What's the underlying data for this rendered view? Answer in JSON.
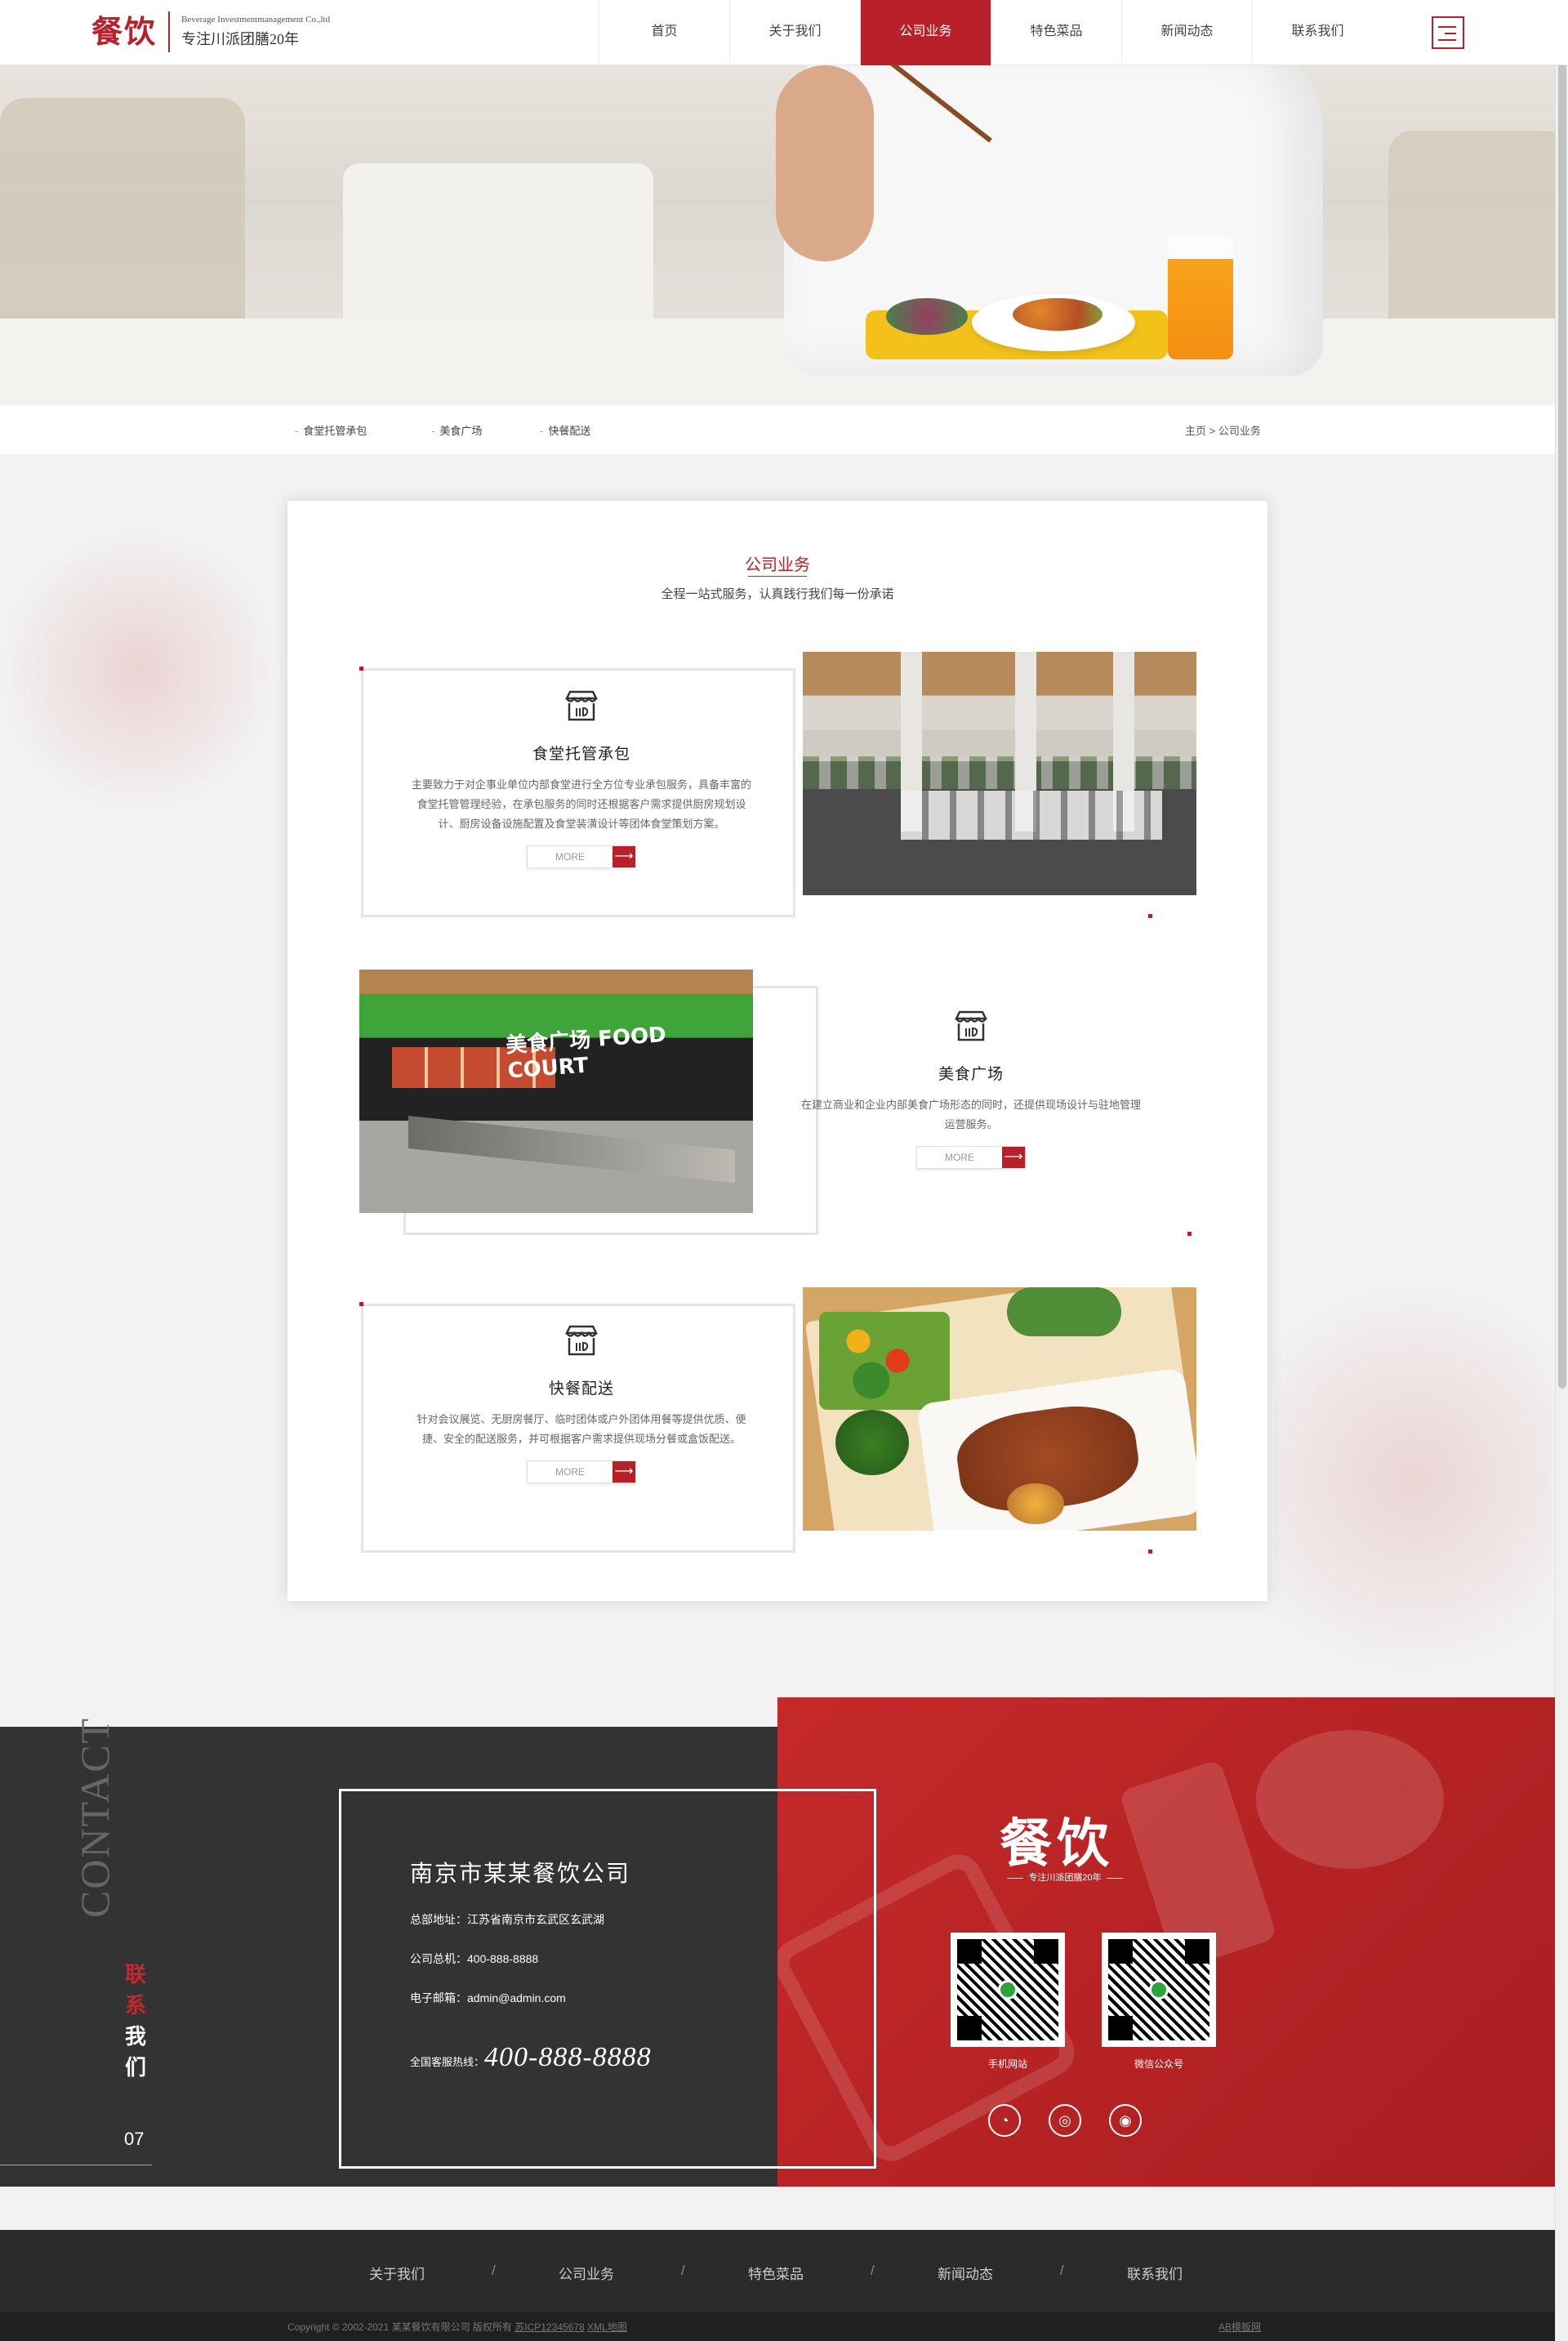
{
  "header": {
    "logo_mark": "餐饮",
    "logo_en": "Beverage Investmentmanagement Co.,ltd",
    "logo_cn": "专注川派团膳20年",
    "nav": [
      {
        "label": "首页",
        "active": false
      },
      {
        "label": "关于我们",
        "active": false
      },
      {
        "label": "公司业务",
        "active": true
      },
      {
        "label": "特色菜品",
        "active": false
      },
      {
        "label": "新闻动态",
        "active": false
      },
      {
        "label": "联系我们",
        "active": false
      }
    ],
    "menu_icon": "hamburger-icon"
  },
  "subnav": {
    "items": [
      "食堂托管承包",
      "美食广场",
      "快餐配送"
    ],
    "breadcrumb": "主页 > 公司业务"
  },
  "section": {
    "title": "公司业务",
    "subtitle": "全程一站式服务，认真践行我们每一份承诺"
  },
  "services": [
    {
      "title": "食堂托管承包",
      "desc": "主要致力于对企事业单位内部食堂进行全方位专业承包服务，具备丰富的食堂托管管理经验，在承包服务的同时还根据客户需求提供厨房规划设计、厨房设备设施配置及食堂装潢设计等团体食堂策划方案。",
      "more": "MORE",
      "icon": "market-stall-icon"
    },
    {
      "title": "美食广场",
      "desc": "在建立商业和企业内部美食广场形态的同时，还提供现场设计与驻地管理运营服务。",
      "more": "MORE",
      "icon": "market-stall-icon",
      "photo_sign": "美食广场 FOOD COURT"
    },
    {
      "title": "快餐配送",
      "desc": "针对会议展览、无厨房餐厅、临时团体或户外团体用餐等提供优质、便捷、安全的配送服务，并可根据客户需求提供现场分餐或盒饭配送。",
      "more": "MORE",
      "icon": "market-stall-icon"
    }
  ],
  "contact": {
    "vertical_en": "CONTACT",
    "vertical_cn": [
      "联",
      "系",
      "我",
      "们"
    ],
    "number": "07",
    "company": "南京市某某餐饮公司",
    "address": "总部地址：江苏省南京市玄武区玄武湖",
    "phone": "公司总机：400-888-8888",
    "email": "电子邮箱：admin@admin.com",
    "hotline_label": "全国客服热线：",
    "hotline": "400-888-8888",
    "brand": "餐饮",
    "brand_tag": "专注川派团膳20年",
    "qr_codes": [
      {
        "label": "手机网站"
      },
      {
        "label": "微信公众号"
      }
    ],
    "social_icons": [
      "qq-icon",
      "wechat-icon",
      "weibo-icon"
    ]
  },
  "footer": {
    "nav": [
      "关于我们",
      "公司业务",
      "特色菜品",
      "新闻动态",
      "联系我们"
    ],
    "separator": "/",
    "copyright": "Copyright © 2002-2021 某某餐饮有限公司 版权所有",
    "icp": "苏ICP12345678",
    "xml": "XML地图",
    "ab": "AB模板网"
  },
  "colors": {
    "accent": "#b8202a",
    "dark": "#333333",
    "footer": "#2b2b2b"
  }
}
